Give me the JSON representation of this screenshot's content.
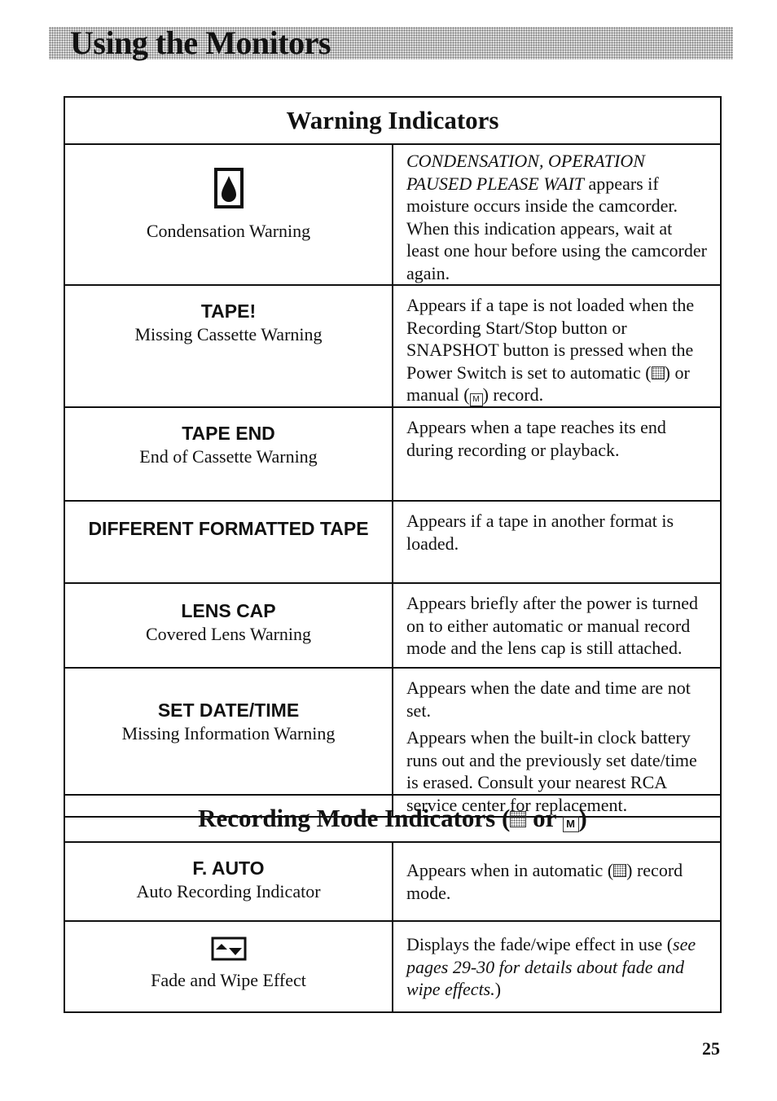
{
  "header": {
    "title": "Using the Monitors"
  },
  "warning_table": {
    "title": "Warning Indicators",
    "rows": [
      {
        "icon": "condensation-drop-icon",
        "caption": "Condensation Warning",
        "desc_italic": "CONDENSATION, OPERATION PAUSED PLEASE WAIT",
        "desc": " appears if moisture occurs inside the camcorder. When this indication appears, wait at least one hour before using the camcorder again."
      },
      {
        "label": "TAPE!",
        "caption": "Missing Cassette Warning",
        "desc_a": "Appears if a tape is not loaded when the Recording Start/Stop button or SNAPSHOT button is pressed when the Power Switch is set to automatic (",
        "desc_b": ") or manual (",
        "desc_c": ") record."
      },
      {
        "label": "TAPE END",
        "caption": "End of Cassette Warning",
        "desc": "Appears when a tape reaches its end during recording or playback."
      },
      {
        "label": "DIFFERENT FORMATTED TAPE",
        "desc": "Appears if a tape in another format is loaded."
      },
      {
        "label": "LENS CAP",
        "caption": "Covered Lens Warning",
        "desc": "Appears briefly after the power is turned on to either automatic or manual record mode and the lens cap is still attached."
      },
      {
        "label": "SET DATE/TIME",
        "caption": "Missing Information Warning",
        "desc": "Appears when the date and time are not set.",
        "desc2": "Appears when the built-in clock battery runs out and the previously set date/time is erased. Consult your nearest RCA service center for replacement."
      }
    ]
  },
  "mode_table": {
    "title_a": "Recording Mode Indicators (",
    "title_b": " or ",
    "title_c": ")",
    "manual_glyph": "M",
    "rows": [
      {
        "label": "F. AUTO",
        "caption": "Auto Recording Indicator",
        "desc_a": "Appears when in automatic (",
        "desc_b": ") record mode."
      },
      {
        "icon": "fade-wipe-icon",
        "caption": "Fade and Wipe Effect",
        "desc": "Displays the fade/wipe effect in use (",
        "desc_italic": "see pages 29-30 for details about fade and wipe effects.",
        "desc_end": ")"
      }
    ]
  },
  "page_number": "25"
}
